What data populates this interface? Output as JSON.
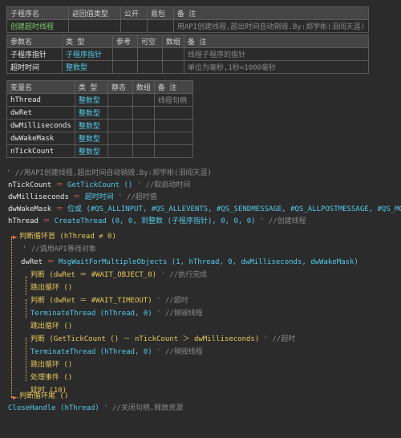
{
  "sub_table": {
    "headers": [
      "子程序名",
      "返回值类型",
      "公开",
      "易包",
      "备 注"
    ],
    "row": {
      "name": "创建超时线程",
      "ret": "",
      "pub": "",
      "easy": "",
      "note": "用API创建线程,超出时间自动销毁.By:郑学彬(泪阎天涯)"
    }
  },
  "param_table": {
    "headers": [
      "参数名",
      "类 型",
      "参考",
      "可空",
      "数组",
      "备 注"
    ],
    "rows": [
      {
        "name": "子程序指针",
        "type": "子程序指针",
        "ref": "",
        "empty": "",
        "arr": "",
        "note": "线程子程序的指针"
      },
      {
        "name": "超时时间",
        "type": "整数型",
        "ref": "",
        "empty": "",
        "arr": "",
        "note": "单位为毫秒,1秒=1000毫秒"
      }
    ]
  },
  "var_table": {
    "headers": [
      "变量名",
      "类 型",
      "静态",
      "数组",
      "备 注"
    ],
    "rows": [
      {
        "name": "hThread",
        "type": "整数型",
        "note": "线程句柄"
      },
      {
        "name": "dwRet",
        "type": "整数型",
        "note": ""
      },
      {
        "name": "dwMilliseconds",
        "type": "整数型",
        "note": ""
      },
      {
        "name": "dwWakeMask",
        "type": "整数型",
        "note": ""
      },
      {
        "name": "nTickCount",
        "type": "整数型",
        "note": ""
      }
    ]
  },
  "code": {
    "l1": "' //用API创建线程,超出时间自动销毁.By:郑学彬(泪阎天涯)",
    "l2a": "nTickCount",
    "l2b": " ＝ ",
    "l2c": "GetTickCount ()",
    "l2d": "  ' //取启动时间",
    "l3a": "dwMilliseconds",
    "l3b": " ＝ ",
    "l3c": "超时时间",
    "l3d": "  ' //超时值",
    "l4a": "dwWakeMask",
    "l4b": " ＝ ",
    "l4c": "位或 (#QS_ALLINPUT, #QS_ALLEVENTS, #QS_SENDMESSAGE, #QS_ALLPOSTMESSAGE, #QS_MOUSE)",
    "l5a": "hThread",
    "l5b": " ＝ ",
    "l5c": "CreateThread (0, 0, 到整数 (子程序指针), 0, 0, 0)",
    "l5d": "  ' //创建线程",
    "l6": "判断循环首 (hThread ≠ 0)",
    "l7": "' //调用API等待对象",
    "l8a": "dwRet",
    "l8b": " ＝ ",
    "l8c": "MsgWaitForMultipleObjects (1, hThread, 0, dwMilliseconds, dwWakeMask)",
    "l9a": "判断 (dwRet ＝ #WAIT_OBJECT_0)",
    "l9b": "  ' //执行完成",
    "l10": "跳出循环 ()",
    "l11a": "判断 (dwRet ＝ #WAIT_TIMEOUT)",
    "l11b": "  ' //超时",
    "l12a": "TerminateThread (hThread, 0)",
    "l12b": "  ' //销毁线程",
    "l13": "跳出循环 ()",
    "l14a": "判断 (GetTickCount () － nTickCount ＞ dwMilliseconds)",
    "l14b": "  ' //超时",
    "l15a": "TerminateThread (hThread, 0)",
    "l15b": "  ' //销毁线程",
    "l16": "跳出循环 ()",
    "l17": "处理事件 ()",
    "l18": "延时 (10)",
    "l19": "判断循环尾 ()",
    "l20a": "CloseHandle (hThread)",
    "l20b": "  ' //关闭句柄,释放资源"
  }
}
